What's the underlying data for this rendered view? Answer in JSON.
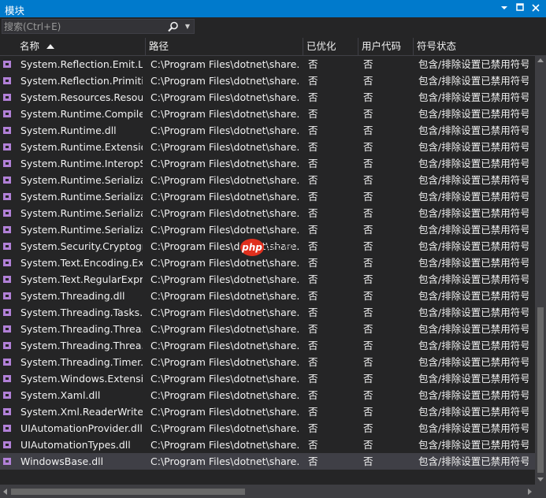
{
  "window": {
    "title": "模块",
    "dropdown_icon": "chevron-down-icon",
    "pin_icon": "pin-icon",
    "close_icon": "close-icon"
  },
  "search": {
    "placeholder": "搜索(Ctrl+E)",
    "value": "",
    "icon": "search-icon"
  },
  "columns": [
    {
      "key": "name",
      "label": "名称",
      "sorted": "ascending"
    },
    {
      "key": "path",
      "label": "路径"
    },
    {
      "key": "optimized",
      "label": "已优化"
    },
    {
      "key": "user_code",
      "label": "用户代码"
    },
    {
      "key": "symbol_status",
      "label": "符号状态"
    }
  ],
  "rows": [
    {
      "name": "System.Reflection.Emit.Li...",
      "path": "C:\\Program Files\\dotnet\\share...",
      "optimized": "否",
      "user_code": "否",
      "symbol_status": "包含/排除设置已禁用符号..."
    },
    {
      "name": "System.Reflection.Primiti...",
      "path": "C:\\Program Files\\dotnet\\share...",
      "optimized": "否",
      "user_code": "否",
      "symbol_status": "包含/排除设置已禁用符号..."
    },
    {
      "name": "System.Resources.Resou...",
      "path": "C:\\Program Files\\dotnet\\share...",
      "optimized": "否",
      "user_code": "否",
      "symbol_status": "包含/排除设置已禁用符号..."
    },
    {
      "name": "System.Runtime.Compile...",
      "path": "C:\\Program Files\\dotnet\\share...",
      "optimized": "否",
      "user_code": "否",
      "symbol_status": "包含/排除设置已禁用符号..."
    },
    {
      "name": "System.Runtime.dll",
      "path": "C:\\Program Files\\dotnet\\share...",
      "optimized": "否",
      "user_code": "否",
      "symbol_status": "包含/排除设置已禁用符号..."
    },
    {
      "name": "System.Runtime.Extensio...",
      "path": "C:\\Program Files\\dotnet\\share...",
      "optimized": "否",
      "user_code": "否",
      "symbol_status": "包含/排除设置已禁用符号..."
    },
    {
      "name": "System.Runtime.InteropS...",
      "path": "C:\\Program Files\\dotnet\\share...",
      "optimized": "否",
      "user_code": "否",
      "symbol_status": "包含/排除设置已禁用符号..."
    },
    {
      "name": "System.Runtime.Serializa...",
      "path": "C:\\Program Files\\dotnet\\share...",
      "optimized": "否",
      "user_code": "否",
      "symbol_status": "包含/排除设置已禁用符号..."
    },
    {
      "name": "System.Runtime.Serializa...",
      "path": "C:\\Program Files\\dotnet\\share...",
      "optimized": "否",
      "user_code": "否",
      "symbol_status": "包含/排除设置已禁用符号..."
    },
    {
      "name": "System.Runtime.Serializa...",
      "path": "C:\\Program Files\\dotnet\\share...",
      "optimized": "否",
      "user_code": "否",
      "symbol_status": "包含/排除设置已禁用符号..."
    },
    {
      "name": "System.Runtime.Serializa...",
      "path": "C:\\Program Files\\dotnet\\share...",
      "optimized": "否",
      "user_code": "否",
      "symbol_status": "包含/排除设置已禁用符号..."
    },
    {
      "name": "System.Security.Cryptogr...",
      "path": "C:\\Program Files\\dotnet\\share...",
      "optimized": "否",
      "user_code": "否",
      "symbol_status": "包含/排除设置已禁用符号..."
    },
    {
      "name": "System.Text.Encoding.Ex...",
      "path": "C:\\Program Files\\dotnet\\share...",
      "optimized": "否",
      "user_code": "否",
      "symbol_status": "包含/排除设置已禁用符号..."
    },
    {
      "name": "System.Text.RegularExpr...",
      "path": "C:\\Program Files\\dotnet\\share...",
      "optimized": "否",
      "user_code": "否",
      "symbol_status": "包含/排除设置已禁用符号..."
    },
    {
      "name": "System.Threading.dll",
      "path": "C:\\Program Files\\dotnet\\share...",
      "optimized": "否",
      "user_code": "否",
      "symbol_status": "包含/排除设置已禁用符号..."
    },
    {
      "name": "System.Threading.Tasks....",
      "path": "C:\\Program Files\\dotnet\\share...",
      "optimized": "否",
      "user_code": "否",
      "symbol_status": "包含/排除设置已禁用符号..."
    },
    {
      "name": "System.Threading.Threa...",
      "path": "C:\\Program Files\\dotnet\\share...",
      "optimized": "否",
      "user_code": "否",
      "symbol_status": "包含/排除设置已禁用符号..."
    },
    {
      "name": "System.Threading.Threa...",
      "path": "C:\\Program Files\\dotnet\\share...",
      "optimized": "否",
      "user_code": "否",
      "symbol_status": "包含/排除设置已禁用符号..."
    },
    {
      "name": "System.Threading.Timer....",
      "path": "C:\\Program Files\\dotnet\\share...",
      "optimized": "否",
      "user_code": "否",
      "symbol_status": "包含/排除设置已禁用符号..."
    },
    {
      "name": "System.Windows.Extensi...",
      "path": "C:\\Program Files\\dotnet\\share...",
      "optimized": "否",
      "user_code": "否",
      "symbol_status": "包含/排除设置已禁用符号..."
    },
    {
      "name": "System.Xaml.dll",
      "path": "C:\\Program Files\\dotnet\\share...",
      "optimized": "否",
      "user_code": "否",
      "symbol_status": "包含/排除设置已禁用符号..."
    },
    {
      "name": "System.Xml.ReaderWrite...",
      "path": "C:\\Program Files\\dotnet\\share...",
      "optimized": "否",
      "user_code": "否",
      "symbol_status": "包含/排除设置已禁用符号..."
    },
    {
      "name": "UIAutomationProvider.dll",
      "path": "C:\\Program Files\\dotnet\\share...",
      "optimized": "否",
      "user_code": "否",
      "symbol_status": "包含/排除设置已禁用符号..."
    },
    {
      "name": "UIAutomationTypes.dll",
      "path": "C:\\Program Files\\dotnet\\share...",
      "optimized": "否",
      "user_code": "否",
      "symbol_status": "包含/排除设置已禁用符号..."
    },
    {
      "name": "WindowsBase.dll",
      "path": "C:\\Program Files\\dotnet\\share...",
      "optimized": "否",
      "user_code": "否",
      "symbol_status": "包含/排除设置已禁用符号...",
      "selected": true
    }
  ],
  "row_icon": "module-icon",
  "watermark": {
    "badge": "php",
    "text": "中文网"
  },
  "colors": {
    "titlebar": "#007acc",
    "background": "#252526",
    "selected_row": "#3f3f46",
    "module_icon": "#b180d7",
    "text": "#f1f1f1"
  }
}
